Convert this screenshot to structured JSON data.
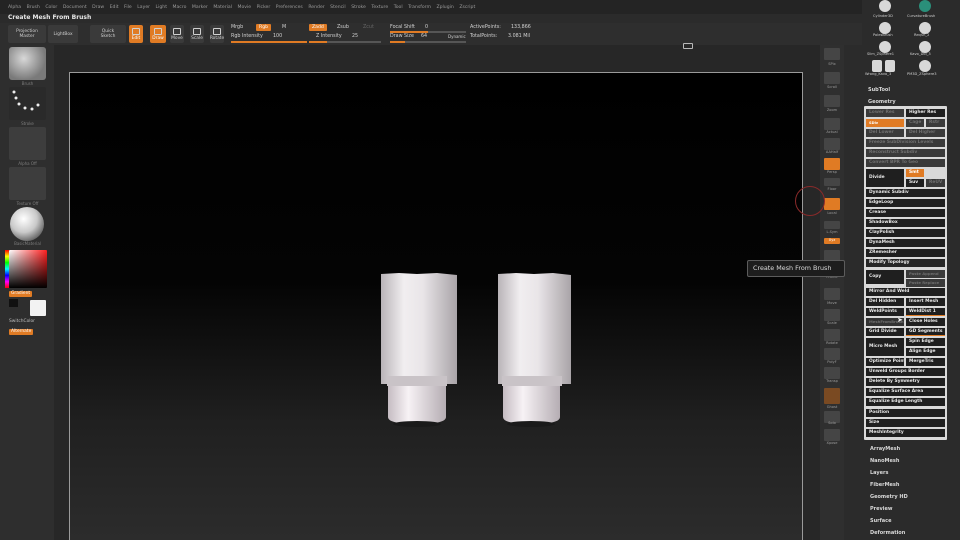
{
  "menubar": [
    "Alpha",
    "Brush",
    "Color",
    "Document",
    "Draw",
    "Edit",
    "File",
    "Layer",
    "Light",
    "Macro",
    "Marker",
    "Material",
    "Movie",
    "Picker",
    "Preferences",
    "Render",
    "Stencil",
    "Stroke",
    "Texture",
    "Tool",
    "Transform",
    "Zplugin",
    "Zscript"
  ],
  "title": "Create Mesh From Brush",
  "toolbar": {
    "projection_master": "Projection\nMaster",
    "lightbox": "LightBox",
    "quick_sketch": "Quick\nSketch",
    "edit": "Edit",
    "draw": "Draw",
    "move": "Move",
    "scale": "Scale",
    "rotate": "Rotate",
    "mrgb": "Mrgb",
    "rgb": "Rgb",
    "m": "M",
    "rgb_intensity_label": "Rgb Intensity",
    "rgb_intensity_value": "100",
    "zadd": "Zadd",
    "zsub": "Zsub",
    "zcut": "Zcut",
    "z_intensity_label": "Z Intensity",
    "z_intensity_value": "25",
    "focal_shift_label": "Focal Shift",
    "focal_shift_value": "0",
    "draw_size_label": "Draw Size",
    "draw_size_value": "64",
    "dynamic": "Dynamic",
    "active_points_label": "ActivePoints:",
    "active_points_value": "133,866",
    "total_points_label": "TotalPoints:",
    "total_points_value": "3.081 Mil"
  },
  "lefttray": {
    "brush": "Brush",
    "stroke": "Stroke",
    "alpha": "Alpha Off",
    "texture": "Texture Off",
    "material": "BasicMaterial",
    "gradient": "Gradient",
    "switch_color": "SwitchColor",
    "alternate": "Alternate"
  },
  "rightshelf": [
    "SPix",
    "Scroll",
    "Zoom",
    "Actual",
    "AAHalf",
    "Persp",
    "Floor",
    "Local",
    "L.Sym",
    "Xyz",
    "Frame",
    "Move",
    "Scale",
    "Rotate",
    "PolyF",
    "Transp",
    "Ghost",
    "Solo",
    "Xpose"
  ],
  "tooltip": "Create Mesh From Brush",
  "rightpanel": {
    "tools": [
      "Cylinder3D",
      "CurvatureBrush",
      "PolesBrush",
      "ReqSh_2",
      "Slim_ZSphere1",
      "Kavo_Dol_3",
      "Wrong_Kavo_3",
      "PM3D_ZSphere3"
    ],
    "subtool": "SubTool",
    "geometry": "Geometry",
    "lower_res": "Lower Res",
    "higher_res": "Higher Res",
    "sdiv": "SDiv",
    "cage": "Cage",
    "rstr": "Rstr",
    "del_lower": "Del Lower",
    "del_higher": "Del Higher",
    "freeze_subdiv": "Freeze SubDivision Levels",
    "reconstruct_subdiv": "Reconstruct Subdiv",
    "convert_bpr": "Convert BPR To Geo",
    "divide": "Divide",
    "smt": "Smt",
    "suv": "Suv",
    "reuv": "ReUV",
    "dynamic_subdiv": "Dynamic Subdiv",
    "edgeloop": "EdgeLoop",
    "crease": "Crease",
    "shadowbox": "ShadowBox",
    "claypolish": "ClayPolish",
    "dynamesh": "DynaMesh",
    "zremesher": "ZRemesher",
    "modify_topology": "Modify Topology",
    "copy": "Copy",
    "paste_append": "Paste Append",
    "paste_replace": "Paste Replace",
    "mirror_and_weld": "Mirror And Weld",
    "del_hidden": "Del Hidden",
    "insert_mesh": "Insert Mesh",
    "weldpoints": "WeldPoints",
    "welddist": "WeldDist 1",
    "meshfrombrush": "MeshFromBrush",
    "close_holes": "Close Holes",
    "grid_divide": "Grid Divide",
    "gd_segments": "GD Segments",
    "spin_edge": "Spin Edge",
    "micro_mesh": "Micro Mesh",
    "align_edge": "Align Edge",
    "optimize_points": "Optimize Points",
    "mergetris": "MergeTris",
    "unweld_groups_border": "Unweld Groups Border",
    "delete_by_symmetry": "Delete By Symmetry",
    "equalize_surface_area": "Equalize Surface Area",
    "equalize_edge_length": "Equalize Edge Length",
    "position": "Position",
    "size": "Size",
    "meshintegrity": "MeshIntegrity",
    "sections": [
      "ArrayMesh",
      "NanoMesh",
      "Layers",
      "FiberMesh",
      "Geometry HD",
      "Preview",
      "Surface",
      "Deformation"
    ]
  },
  "colors": {
    "accent": "#e07b24",
    "panel": "#2b2b2b",
    "primary_color": "#ffffff"
  }
}
